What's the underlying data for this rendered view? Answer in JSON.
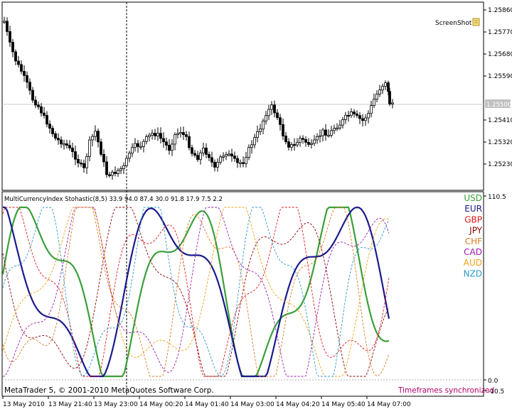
{
  "main_chart": {
    "screenshot_label": "ScreenShot",
    "price_labels": [
      "1.25860",
      "1.25770",
      "1.25680",
      "1.25590",
      "1.25500",
      "1.25410",
      "1.25320",
      "1.25230"
    ],
    "current_price": "1.25500"
  },
  "indicator": {
    "header": "MultiCurrencyIndex  Stohastic(8,5) 33.9 94.0 87.4 30.0 91.8 17.9 7.5 2.2",
    "scale_labels": [
      "110.5",
      "0.0",
      "-10.5"
    ],
    "currencies": [
      {
        "name": "USD",
        "color": "#3aa03a"
      },
      {
        "name": "EUR",
        "color": "#1a1a8c"
      },
      {
        "name": "GBP",
        "color": "#e01818"
      },
      {
        "name": "JPY",
        "color": "#8b0000"
      },
      {
        "name": "CHF",
        "color": "#e07a20"
      },
      {
        "name": "CAD",
        "color": "#9b19b0"
      },
      {
        "name": "AUD",
        "color": "#f0a010"
      },
      {
        "name": "NZD",
        "color": "#2a9ac8"
      }
    ],
    "copyright": "MetaTrader 5, © 2001-2010 MetaQuotes Software Corp.",
    "sync_text": "Timeframes synchronized"
  },
  "time_axis": [
    "13 May 2010",
    "13 May 21:40",
    "13 May 23:00",
    "14 May 00:20",
    "14 May 01:40",
    "14 May 03:00",
    "14 May 04:20",
    "14 May 05:40",
    "14 May 07:00"
  ]
}
